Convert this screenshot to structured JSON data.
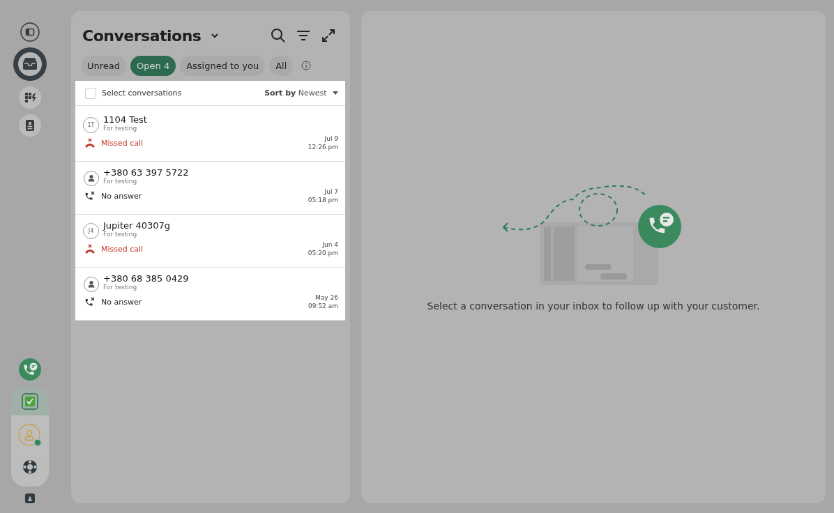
{
  "nav": [
    {
      "kind": "panel"
    },
    {
      "kind": "inbox"
    },
    {
      "kind": "apps"
    },
    {
      "kind": "contacts"
    }
  ],
  "nav_bottom": [
    {
      "kind": "phone"
    },
    {
      "kind": "task"
    },
    {
      "kind": "profile"
    },
    {
      "kind": "help"
    },
    {
      "kind": "logo"
    }
  ],
  "conversations": {
    "title": "Conversations",
    "filters": [
      {
        "label": "Unread",
        "selected": false
      },
      {
        "label": "Open",
        "count": "4",
        "selected": true
      },
      {
        "label": "Assigned to you",
        "selected": false
      },
      {
        "label": "All",
        "selected": false
      }
    ],
    "select_all": {
      "label": "Select conversations",
      "checked": false
    },
    "sort": {
      "label": "Sort by",
      "value": "Newest"
    },
    "rows": [
      {
        "avatar": {
          "kind": "initials",
          "text": "1T"
        },
        "name": "1104 Test",
        "subtitle": "For testing",
        "status": {
          "kind": "missed",
          "text": "Missed call"
        },
        "date": "Jul 9",
        "time": "12:26 pm"
      },
      {
        "avatar": {
          "kind": "person"
        },
        "name": "+380 63 397 5722",
        "subtitle": "For testing",
        "status": {
          "kind": "no_answer",
          "text": "No answer"
        },
        "date": "Jul 7",
        "time": "05:18 pm"
      },
      {
        "avatar": {
          "kind": "initials",
          "text": "J4"
        },
        "name": "Jupiter 40307g",
        "subtitle": "For testing",
        "status": {
          "kind": "missed",
          "text": "Missed call"
        },
        "date": "Jun 4",
        "time": "05:20 pm"
      },
      {
        "avatar": {
          "kind": "person"
        },
        "name": "+380 68 385 0429",
        "subtitle": "For testing",
        "status": {
          "kind": "no_answer",
          "text": "No answer"
        },
        "date": "May 26",
        "time": "09:52 am"
      }
    ]
  },
  "empty_state": {
    "message": "Select a conversation in your inbox to follow up with your customer."
  }
}
